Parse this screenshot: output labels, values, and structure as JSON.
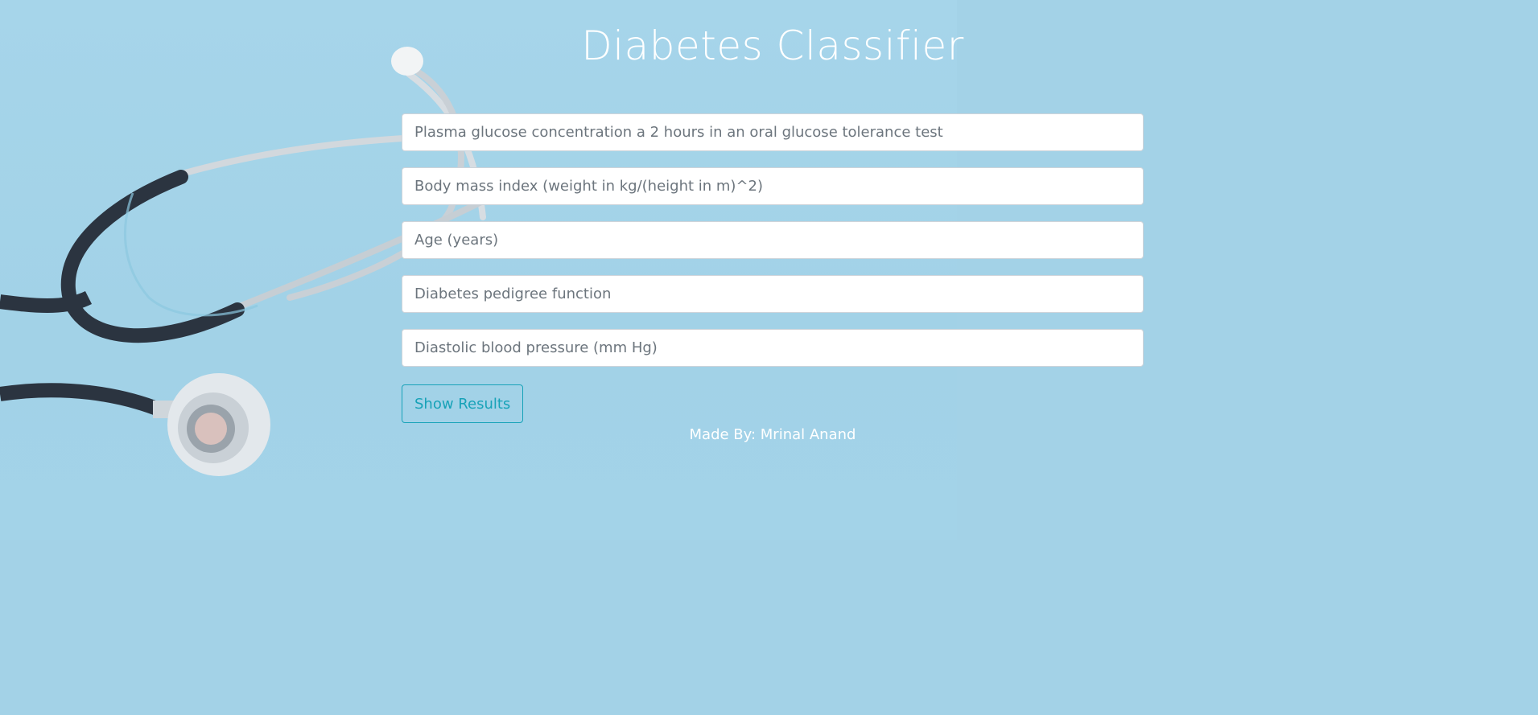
{
  "page": {
    "title": "Diabetes Classifier",
    "credit": "Made By: Mrinal Anand"
  },
  "form": {
    "fields": [
      {
        "placeholder": "Plasma glucose concentration a 2 hours in an oral glucose tolerance test"
      },
      {
        "placeholder": "Body mass index (weight in kg/(height in m)^2)"
      },
      {
        "placeholder": "Age (years)"
      },
      {
        "placeholder": "Diabetes pedigree function"
      },
      {
        "placeholder": "Diastolic blood pressure (mm Hg)"
      }
    ],
    "submit_label": "Show Results"
  },
  "background": {
    "image": "stethoscope-illustration",
    "colors": {
      "page": "#a3d2e7",
      "button_accent": "#17a2b8"
    }
  }
}
